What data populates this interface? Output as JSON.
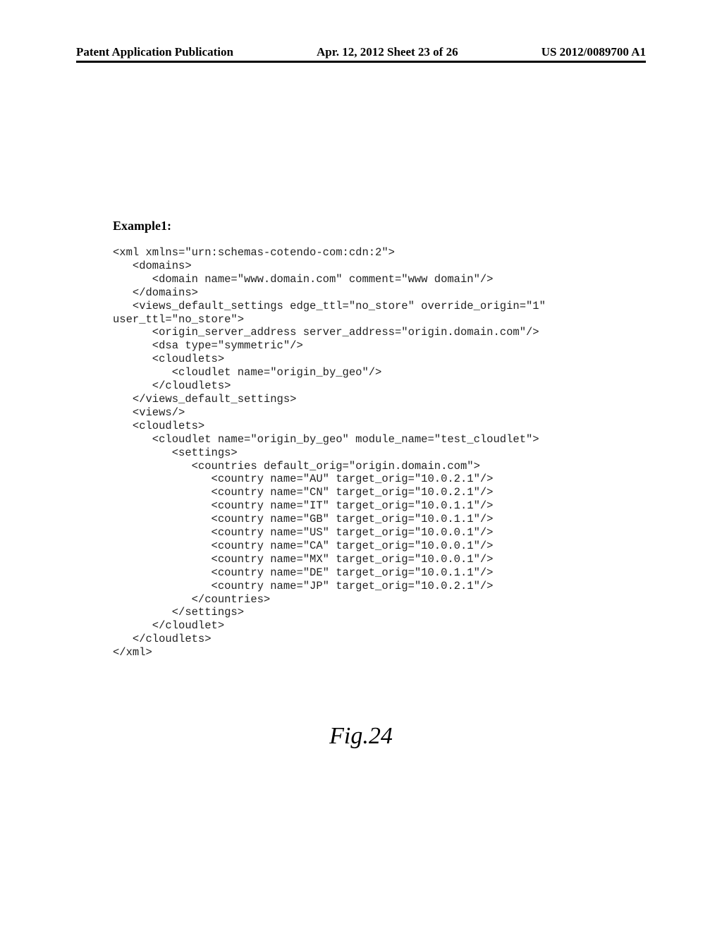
{
  "header": {
    "left": "Patent Application Publication",
    "center": "Apr. 12, 2012  Sheet 23 of 26",
    "right": "US 2012/0089700 A1"
  },
  "example_title": "Example1:",
  "code_text": "<xml xmlns=\"urn:schemas-cotendo-com:cdn:2\">\n   <domains>\n      <domain name=\"www.domain.com\" comment=\"www domain\"/>\n   </domains>\n   <views_default_settings edge_ttl=\"no_store\" override_origin=\"1\"\nuser_ttl=\"no_store\">\n      <origin_server_address server_address=\"origin.domain.com\"/>\n      <dsa type=\"symmetric\"/>\n      <cloudlets>\n         <cloudlet name=\"origin_by_geo\"/>\n      </cloudlets>\n   </views_default_settings>\n   <views/>\n   <cloudlets>\n      <cloudlet name=\"origin_by_geo\" module_name=\"test_cloudlet\">\n         <settings>\n            <countries default_orig=\"origin.domain.com\">\n               <country name=\"AU\" target_orig=\"10.0.2.1\"/>\n               <country name=\"CN\" target_orig=\"10.0.2.1\"/>\n               <country name=\"IT\" target_orig=\"10.0.1.1\"/>\n               <country name=\"GB\" target_orig=\"10.0.1.1\"/>\n               <country name=\"US\" target_orig=\"10.0.0.1\"/>\n               <country name=\"CA\" target_orig=\"10.0.0.1\"/>\n               <country name=\"MX\" target_orig=\"10.0.0.1\"/>\n               <country name=\"DE\" target_orig=\"10.0.1.1\"/>\n               <country name=\"JP\" target_orig=\"10.0.2.1\"/>\n            </countries>\n         </settings>\n      </cloudlet>\n   </cloudlets>\n</xml>",
  "figure_label": "Fig.24"
}
